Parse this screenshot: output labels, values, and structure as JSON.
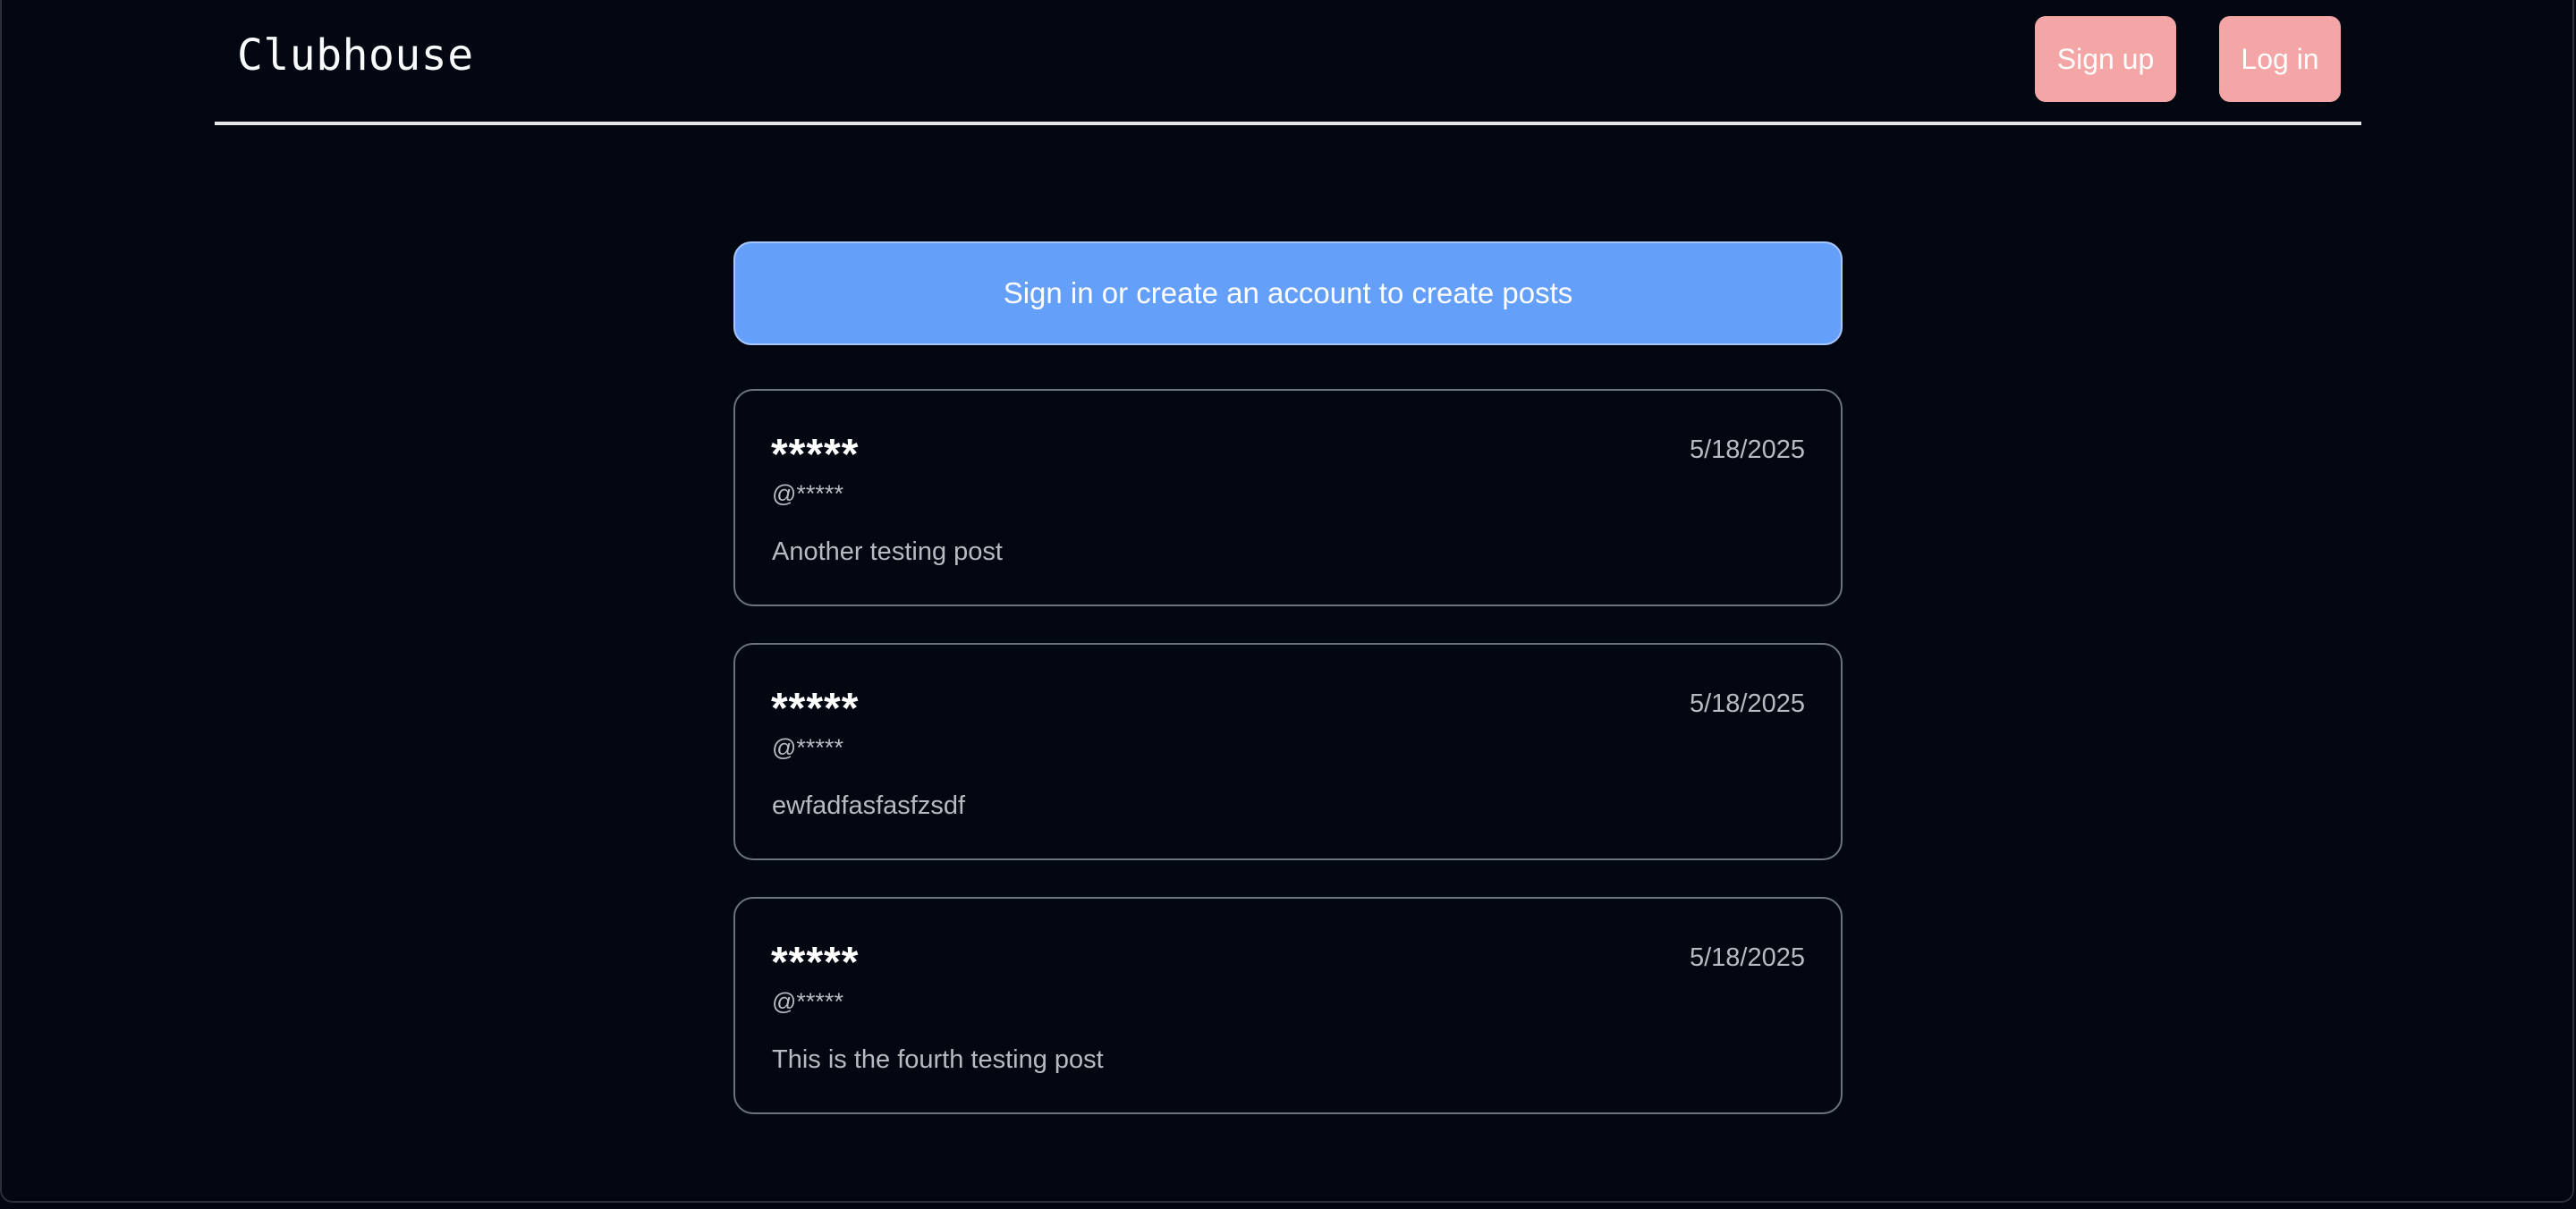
{
  "header": {
    "logo": "Clubhouse",
    "signup_label": "Sign up",
    "login_label": "Log in"
  },
  "main": {
    "cta_label": "Sign in or create an account to create posts",
    "posts": [
      {
        "name": "*****",
        "handle": "@*****",
        "date": "5/18/2025",
        "body": "Another testing post"
      },
      {
        "name": "*****",
        "handle": "@*****",
        "date": "5/18/2025",
        "body": "ewfadfasfasfzsdf"
      },
      {
        "name": "*****",
        "handle": "@*****",
        "date": "5/18/2025",
        "body": "This is the fourth testing post"
      }
    ]
  },
  "colors": {
    "background": "#030712",
    "nav_button": "#f4a5a6",
    "cta_button": "#649ffa",
    "card_border": "#6b7280",
    "muted_text": "#b7bac1"
  }
}
